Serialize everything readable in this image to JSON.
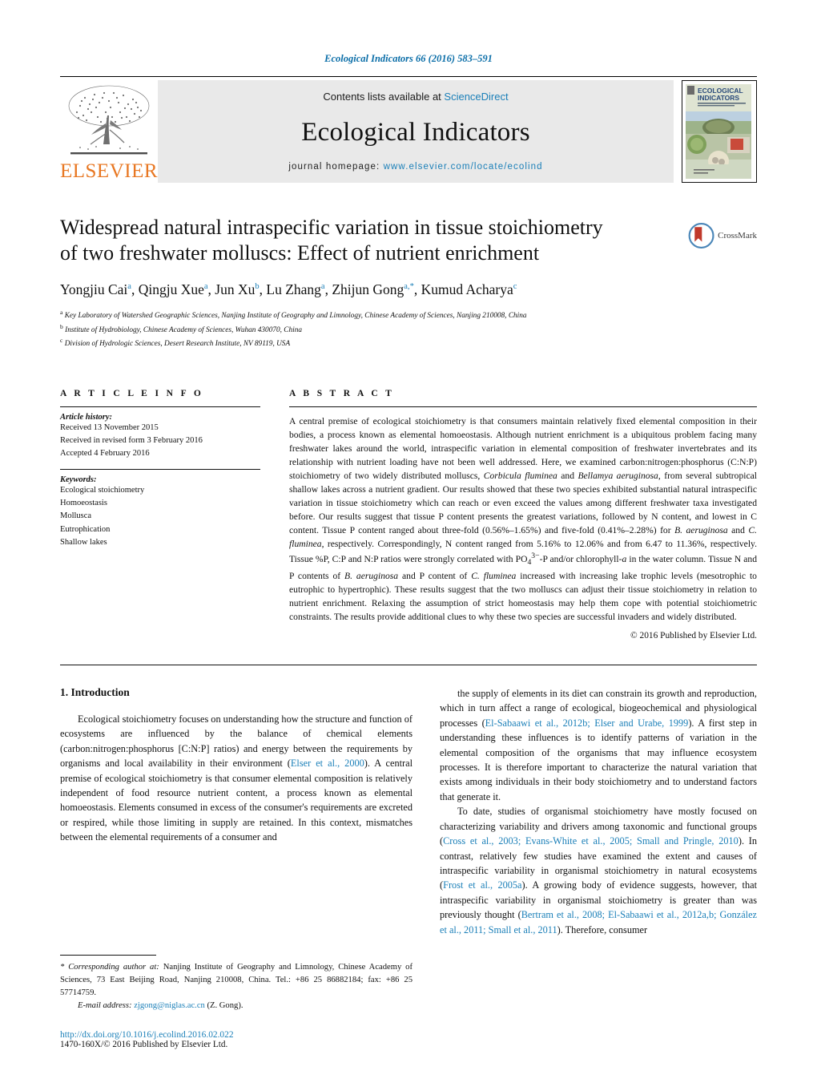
{
  "running_head": "Ecological Indicators 66 (2016) 583–591",
  "banner": {
    "publisher": "ELSEVIER",
    "contents_prefix": "Contents lists available at ",
    "contents_link": "ScienceDirect",
    "journal_name": "Ecological Indicators",
    "homepage_prefix": "journal homepage: ",
    "homepage_url": "www.elsevier.com/locate/ecolind",
    "cover_title_line1": "ECOLOGICAL",
    "cover_title_line2": "INDICATORS"
  },
  "article": {
    "title": "Widespread natural intraspecific variation in tissue stoichiometry of two freshwater molluscs: Effect of nutrient enrichment",
    "authors_html": "Yongjiu Cai<sup>a</sup>, Qingju Xue<sup>a</sup>, Jun Xu<sup>b</sup>, Lu Zhang<sup>a</sup>, Zhijun Gong<sup>a,</sup><sup>*</sup>, Kumud Acharya<sup>c</sup>",
    "affiliations": [
      {
        "marker": "a",
        "text": "Key Laboratory of Watershed Geographic Sciences, Nanjing Institute of Geography and Limnology, Chinese Academy of Sciences, Nanjing 210008, China"
      },
      {
        "marker": "b",
        "text": "Institute of Hydrobiology, Chinese Academy of Sciences, Wuhan 430070, China"
      },
      {
        "marker": "c",
        "text": "Division of Hydrologic Sciences, Desert Research Institute, NV 89119, USA"
      }
    ],
    "crossmark_label": "CrossMark"
  },
  "info": {
    "heading": "A R T I C L E    I N F O",
    "history_label": "Article history:",
    "history": [
      "Received 13 November 2015",
      "Received in revised form 3 February 2016",
      "Accepted 4 February 2016"
    ],
    "keywords_label": "Keywords:",
    "keywords": [
      "Ecological stoichiometry",
      "Homoeostasis",
      "Mollusca",
      "Eutrophication",
      "Shallow lakes"
    ]
  },
  "abstract": {
    "heading": "A B S T R A C T",
    "text_html": "A central premise of ecological stoichiometry is that consumers maintain relatively fixed elemental composition in their bodies, a process known as elemental homoeostasis. Although nutrient enrichment is a ubiquitous problem facing many freshwater lakes around the world, intraspecific variation in elemental composition of freshwater invertebrates and its relationship with nutrient loading have not been well addressed. Here, we examined carbon:nitrogen:phosphorus (C:N:P) stoichiometry of two widely distributed molluscs, <i>Corbicula fluminea</i> and <i>Bellamya aeruginosa</i>, from several subtropical shallow lakes across a nutrient gradient. Our results showed that these two species exhibited substantial natural intraspecific variation in tissue stoichiometry which can reach or even exceed the values among different freshwater taxa investigated before. Our results suggest that tissue P content presents the greatest variations, followed by N content, and lowest in C content. Tissue P content ranged about three-fold (0.56%–1.65%) and five-fold (0.41%–2.28%) for <i>B. aeruginosa</i> and <i>C. fluminea</i>, respectively. Correspondingly, N content ranged from 5.16% to 12.06% and from 6.47 to 11.36%, respectively. Tissue %P, C:P and N:P ratios were strongly correlated with PO<sub>4</sub><sup>3−</sup>-P and/or chlorophyll-<i>a</i> in the water column. Tissue N and P contents of <i>B. aeruginosa</i> and P content of <i>C. fluminea</i> increased with increasing lake trophic levels (mesotrophic to eutrophic to hypertrophic). These results suggest that the two molluscs can adjust their tissue stoichiometry in relation to nutrient enrichment. Relaxing the assumption of strict homeostasis may help them cope with potential stoichiometric constraints. The results provide additional clues to why these two species are successful invaders and widely distributed.",
    "copyright": "© 2016 Published by Elsevier Ltd."
  },
  "body": {
    "section_heading": "1.  Introduction",
    "left_paragraphs_html": [
      "Ecological stoichiometry focuses on understanding how the structure and function of ecosystems are influenced by the balance of chemical elements (carbon:nitrogen:phosphorus [C:N:P] ratios) and energy between the requirements by organisms and local availability in their environment (<span class=\"ref\">Elser et al., 2000</span>). A central premise of ecological stoichiometry is that consumer elemental composition is relatively independent of food resource nutrient content, a process known as elemental homoeostasis. Elements consumed in excess of the consumer's requirements are excreted or respired, while those limiting in supply are retained. In this context, mismatches between the elemental requirements of a consumer and"
    ],
    "right_paragraphs_html": [
      "the supply of elements in its diet can constrain its growth and reproduction, which in turn affect a range of ecological, biogeochemical and physiological processes (<span class=\"ref\">El-Sabaawi et al., 2012b; Elser and Urabe, 1999</span>). A first step in understanding these influences is to identify patterns of variation in the elemental composition of the organisms that may influence ecosystem processes. It is therefore important to characterize the natural variation that exists among individuals in their body stoichiometry and to understand factors that generate it.",
      "To date, studies of organismal stoichiometry have mostly focused on characterizing variability and drivers among taxonomic and functional groups (<span class=\"ref\">Cross et al., 2003; Evans-White et al., 2005; Small and Pringle, 2010</span>). In contrast, relatively few studies have examined the extent and causes of intraspecific variability in organismal stoichiometry in natural ecosystems (<span class=\"ref\">Frost et al., 2005a</span>). A growing body of evidence suggests, however, that intraspecific variability in organismal stoichiometry is greater than was previously thought (<span class=\"ref\">Bertram et al., 2008; El-Sabaawi et al., 2012a,b; González et al., 2011; Small et al., 2011</span>). Therefore, consumer"
    ]
  },
  "footnotes": {
    "corresponding_html": "<span style=\"font-style:italic\">*  Corresponding author at:</span> Nanjing Institute of Geography and Limnology, Chinese Academy of Sciences, 73 East Beijing Road, Nanjing 210008, China. Tel.: +86 25 86882184; fax: +86 25 57714759.",
    "email_label": "E-mail address:",
    "email": "zjgong@niglas.ac.cn",
    "email_suffix": "(Z. Gong).",
    "doi": "http://dx.doi.org/10.1016/j.ecolind.2016.02.022",
    "issn_line": "1470-160X/© 2016 Published by Elsevier Ltd."
  },
  "colors": {
    "link": "#1a7fb8",
    "elsevier_orange": "#e87722",
    "banner_gray": "#e9e9e9"
  }
}
